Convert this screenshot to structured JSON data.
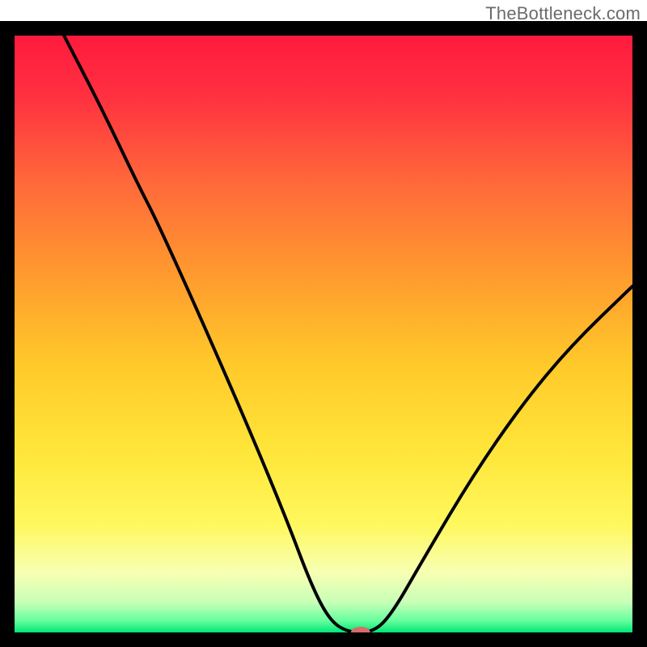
{
  "watermark": "TheBottleneck.com",
  "chart_data": {
    "type": "line",
    "title": "",
    "xlabel": "",
    "ylabel": "",
    "xlim": [
      0,
      100
    ],
    "ylim": [
      0,
      100
    ],
    "gradient_stops": [
      {
        "offset": 0.0,
        "color": "#ff1a3e"
      },
      {
        "offset": 0.1,
        "color": "#ff3040"
      },
      {
        "offset": 0.25,
        "color": "#ff6a3a"
      },
      {
        "offset": 0.4,
        "color": "#ff9a2e"
      },
      {
        "offset": 0.55,
        "color": "#ffc92a"
      },
      {
        "offset": 0.7,
        "color": "#ffe63a"
      },
      {
        "offset": 0.82,
        "color": "#fff85e"
      },
      {
        "offset": 0.9,
        "color": "#f7ffb3"
      },
      {
        "offset": 0.95,
        "color": "#c8ffb7"
      },
      {
        "offset": 0.98,
        "color": "#66ff9e"
      },
      {
        "offset": 1.0,
        "color": "#00e676"
      }
    ],
    "series": [
      {
        "name": "bottleneck-curve",
        "points": [
          {
            "x": 8,
            "y": 100
          },
          {
            "x": 14,
            "y": 88
          },
          {
            "x": 20,
            "y": 75
          },
          {
            "x": 23,
            "y": 69
          },
          {
            "x": 30,
            "y": 53
          },
          {
            "x": 38,
            "y": 34
          },
          {
            "x": 44,
            "y": 19
          },
          {
            "x": 48,
            "y": 8
          },
          {
            "x": 51,
            "y": 2
          },
          {
            "x": 54,
            "y": 0
          },
          {
            "x": 58,
            "y": 0
          },
          {
            "x": 61,
            "y": 3
          },
          {
            "x": 66,
            "y": 12
          },
          {
            "x": 74,
            "y": 26
          },
          {
            "x": 82,
            "y": 38
          },
          {
            "x": 90,
            "y": 48
          },
          {
            "x": 100,
            "y": 58
          }
        ]
      }
    ],
    "marker": {
      "x": 56,
      "y": 0,
      "color": "#d86a6a",
      "rx": 12,
      "ry": 7
    }
  }
}
